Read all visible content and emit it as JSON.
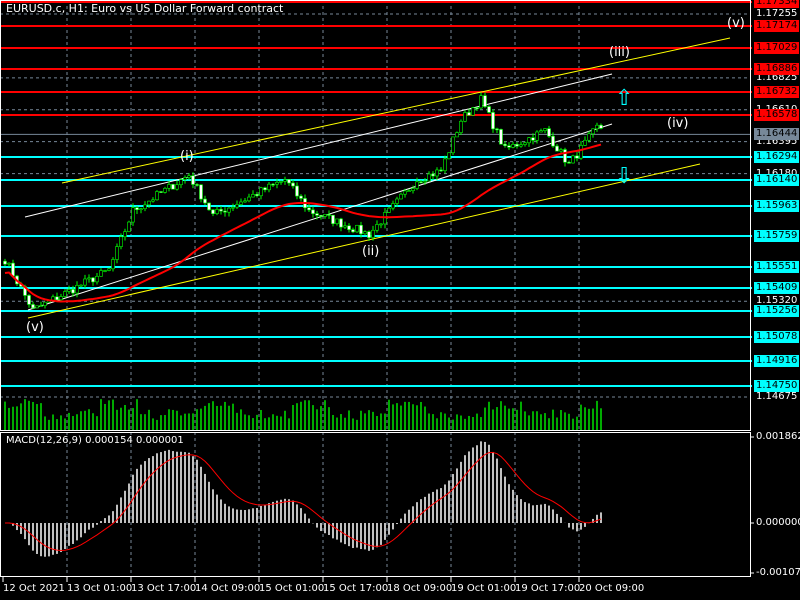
{
  "header": {
    "title": "EURUSD.c, H1:  Euro vs US Dollar Forward contract"
  },
  "macd": {
    "label": "MACD(12,26,9) 0.000154 0.000001",
    "scale": [
      "0.001862",
      "0.000000",
      "-0.001072"
    ]
  },
  "price_scale": [
    "1.17255",
    "1.16825",
    "1.16610",
    "1.16395",
    "1.16180",
    "1.15320",
    "1.14675"
  ],
  "resistance_levels": [
    "1.17334",
    "1.17174",
    "1.17029",
    "1.16886",
    "1.16732",
    "1.16578"
  ],
  "current_price": "1.16444",
  "support_levels": [
    "1.16294",
    "1.16140",
    "1.15963",
    "1.15759",
    "1.15551",
    "1.15409",
    "1.15256",
    "1.15078",
    "1.14916",
    "1.14750"
  ],
  "time_axis": [
    "12 Oct 2021",
    "13 Oct 01:00",
    "13 Oct 17:00",
    "14 Oct 09:00",
    "15 Oct 01:00",
    "15 Oct 17:00",
    "18 Oct 09:00",
    "19 Oct 01:00",
    "19 Oct 17:00",
    "20 Oct 09:00"
  ],
  "wave_labels": {
    "v_start": "(v)",
    "i": "(i)",
    "ii": "(ii)",
    "iii": "(iii)",
    "iv": "(iv)",
    "v_end": "(v)"
  },
  "colors": {
    "bull": "#00ff00",
    "resistance": "#ff0000",
    "support": "#00ffff",
    "ma": "#ff0000",
    "trend": "#ffff00"
  },
  "chart_data": {
    "type": "candlestick",
    "symbol": "EURUSD.c",
    "timeframe": "H1",
    "close_keypoints": [
      [
        0,
        1.156
      ],
      [
        7,
        1.1526
      ],
      [
        26,
        1.1553
      ],
      [
        32,
        1.1593
      ],
      [
        46,
        1.1617
      ],
      [
        52,
        1.159
      ],
      [
        70,
        1.1614
      ],
      [
        76,
        1.1593
      ],
      [
        91,
        1.1577
      ],
      [
        103,
        1.1614
      ],
      [
        109,
        1.162
      ],
      [
        114,
        1.1654
      ],
      [
        119,
        1.1668
      ],
      [
        125,
        1.1634
      ],
      [
        135,
        1.1647
      ],
      [
        141,
        1.1624
      ],
      [
        148,
        1.1649
      ]
    ],
    "ylim": [
      1.1462,
      1.1738
    ]
  }
}
